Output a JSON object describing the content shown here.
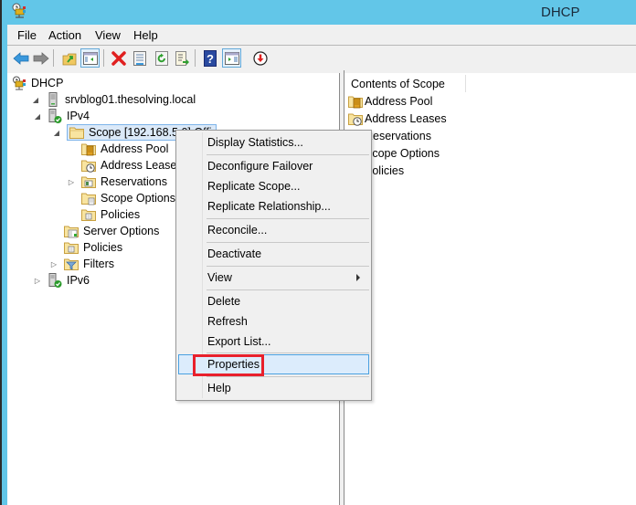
{
  "window": {
    "title": "DHCP",
    "app_icon": "dhcp-icon",
    "frame_color": "#62c6e8"
  },
  "menubar": {
    "items": [
      "File",
      "Action",
      "View",
      "Help"
    ]
  },
  "toolbar": {
    "buttons": [
      {
        "name": "back-button",
        "icon": "arrow-left-icon"
      },
      {
        "name": "forward-button",
        "icon": "arrow-right-icon"
      },
      {
        "name": "up-one-level-button",
        "icon": "folder-up-icon"
      },
      {
        "name": "show-hide-console-tree-button",
        "icon": "console-tree-icon",
        "pressed": true
      },
      {
        "name": "delete-button",
        "icon": "delete-x-icon"
      },
      {
        "name": "properties-button",
        "icon": "properties-icon"
      },
      {
        "name": "refresh-button",
        "icon": "refresh-icon"
      },
      {
        "name": "export-list-button",
        "icon": "export-list-icon"
      },
      {
        "name": "help-button",
        "icon": "help-icon"
      },
      {
        "name": "show-hide-action-pane-button",
        "icon": "action-pane-icon",
        "pressed": true
      },
      {
        "name": "deactivate-button",
        "icon": "down-arrow-circle-icon"
      }
    ]
  },
  "tree": {
    "items": [
      {
        "label": "DHCP",
        "icon": "dhcp-icon",
        "level": 0,
        "expander": ""
      },
      {
        "label": "srvblog01.thesolving.local",
        "icon": "server-icon",
        "level": 1,
        "expander": "expanded"
      },
      {
        "label": "IPv4",
        "icon": "ipv4-server-icon",
        "level": 2,
        "expander": "expanded"
      },
      {
        "label": "Scope [192.168.5.0] Offi",
        "icon": "folder-icon",
        "level": 3,
        "expander": "expanded",
        "selected": true
      },
      {
        "label": "Address Pool",
        "icon": "address-pool-icon",
        "level": 4,
        "expander": ""
      },
      {
        "label": "Address Leases",
        "icon": "address-leases-icon",
        "level": 4,
        "expander": ""
      },
      {
        "label": "Reservations",
        "icon": "reservations-icon",
        "level": 4,
        "expander": "collapsed"
      },
      {
        "label": "Scope Options",
        "icon": "scope-options-icon",
        "level": 4,
        "expander": ""
      },
      {
        "label": "Policies",
        "icon": "policies-icon",
        "level": 4,
        "expander": ""
      },
      {
        "label": "Server Options",
        "icon": "server-options-icon",
        "level": 3,
        "expander": ""
      },
      {
        "label": "Policies",
        "icon": "policies-icon",
        "level": 3,
        "expander": ""
      },
      {
        "label": "Filters",
        "icon": "filters-icon",
        "level": 3,
        "expander": "collapsed"
      },
      {
        "label": "IPv6",
        "icon": "ipv6-server-icon",
        "level": 2,
        "expander": "collapsed"
      }
    ]
  },
  "contents": {
    "column_header": "Contents of Scope",
    "items": [
      {
        "label": "Address Pool",
        "icon": "address-pool-icon"
      },
      {
        "label": "Address Leases",
        "icon": "address-leases-icon"
      },
      {
        "label": "Reservations",
        "icon": "reservations-icon"
      },
      {
        "label": "Scope Options",
        "icon": "scope-options-icon"
      },
      {
        "label": "Policies",
        "icon": "policies-icon"
      }
    ]
  },
  "context_menu": {
    "items": [
      {
        "label": "Display Statistics..."
      },
      {
        "separator": true
      },
      {
        "label": "Deconfigure Failover"
      },
      {
        "label": "Replicate Scope..."
      },
      {
        "label": "Replicate Relationship..."
      },
      {
        "separator": true
      },
      {
        "label": "Reconcile..."
      },
      {
        "separator": true
      },
      {
        "label": "Deactivate"
      },
      {
        "separator": true
      },
      {
        "label": "View",
        "submenu": true
      },
      {
        "separator": true
      },
      {
        "label": "Delete"
      },
      {
        "label": "Refresh"
      },
      {
        "label": "Export List..."
      },
      {
        "separator": true
      },
      {
        "label": "Properties",
        "hover": true,
        "highlighted": true
      },
      {
        "separator": true
      },
      {
        "label": "Help"
      }
    ],
    "highlight_color": "#e8202c"
  }
}
